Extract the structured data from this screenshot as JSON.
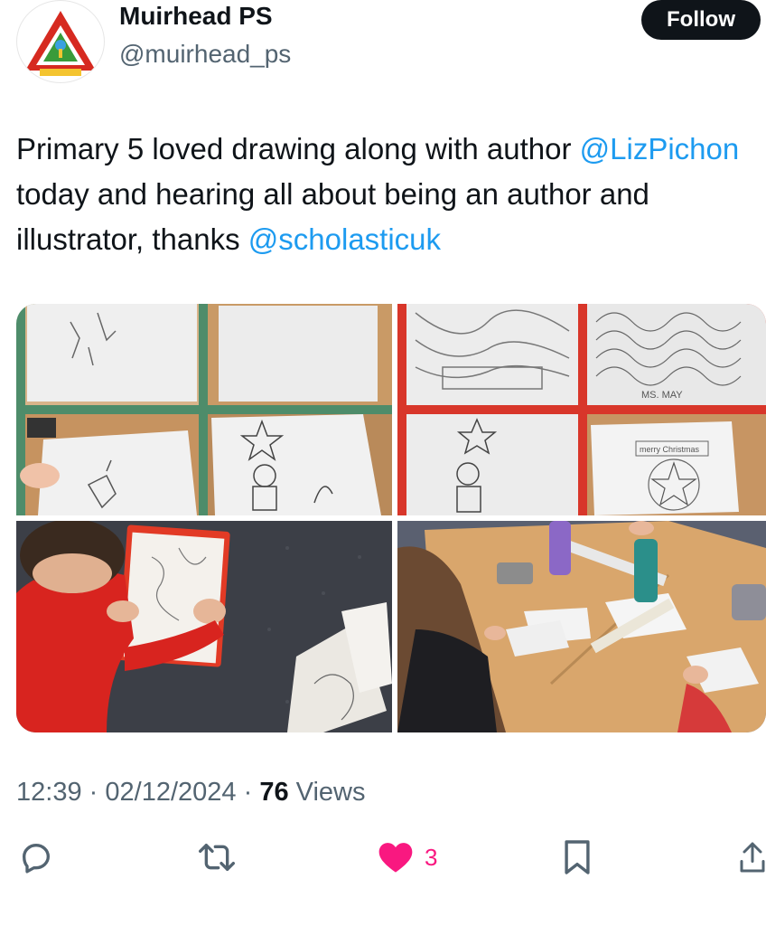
{
  "tweet": {
    "author_name": "Muirhead PS",
    "author_handle": "@muirhead_ps",
    "follow_label": "Follow",
    "text_parts": [
      "Primary 5 loved drawing along with author ",
      "@LizPichon",
      " today and hearing all about being an author and illustrator, thanks ",
      "@scholasticuk"
    ],
    "time": "12:39",
    "separator": "·",
    "date": "02/12/2024",
    "views_count": "76",
    "views_label": "Views",
    "likes": "3"
  },
  "media": [
    {
      "name": "collage-drawings-green",
      "drawing_labels": []
    },
    {
      "name": "collage-drawings-red",
      "drawing_labels": [
        "MS. MAY",
        "merry Christmas"
      ]
    },
    {
      "name": "photo-pupil-drawing-on-clipboard"
    },
    {
      "name": "photo-pupils-drawing-at-tables"
    }
  ],
  "icons": {
    "reply": "reply-icon",
    "retweet": "retweet-icon",
    "like": "heart-icon",
    "bookmark": "bookmark-icon",
    "share": "share-icon"
  },
  "colors": {
    "accent": "#1d9bf0",
    "like": "#f91880",
    "text": "#0f1419",
    "muted": "#536471",
    "collage_green_border": "#4e8c6a",
    "collage_red_border": "#d8362a"
  }
}
